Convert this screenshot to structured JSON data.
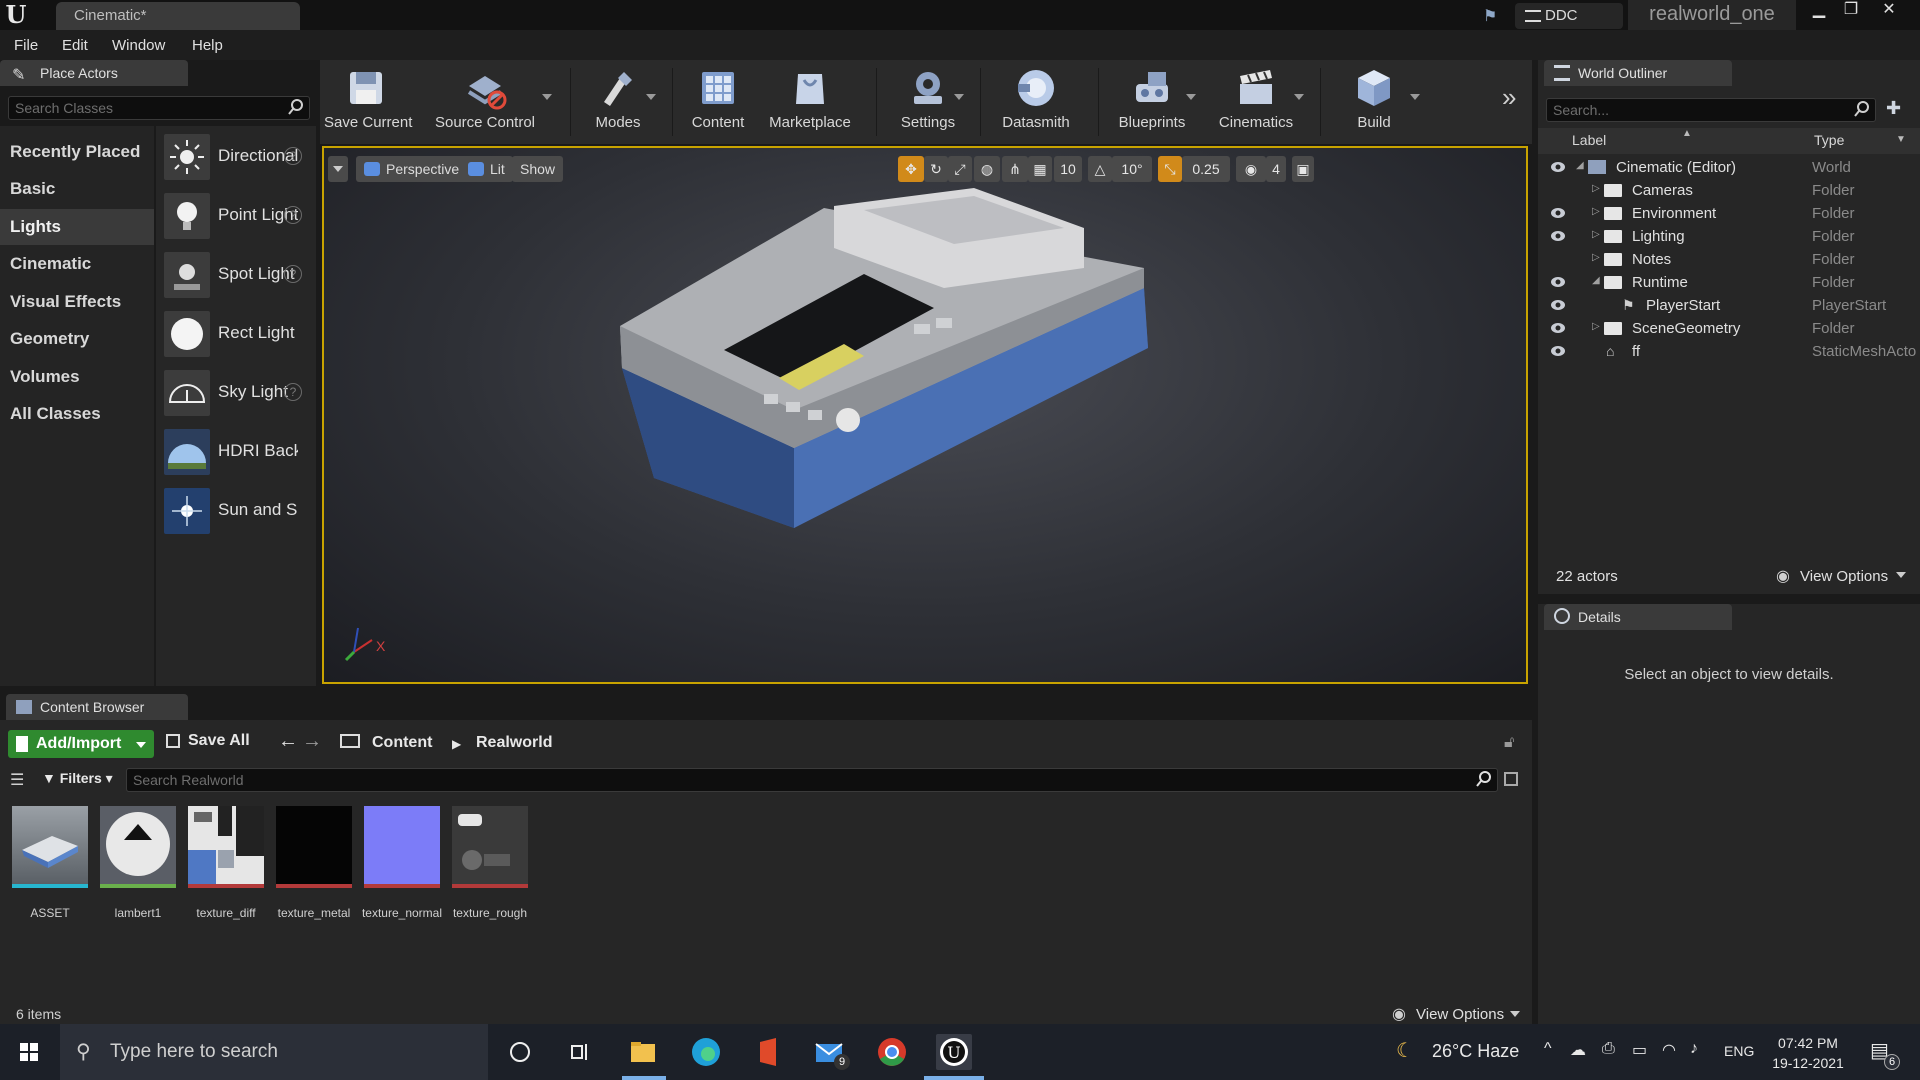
{
  "window": {
    "doc_tab": "Cinematic*",
    "ddc_label": "DDC",
    "project_name": "realworld_one"
  },
  "menu": [
    "File",
    "Edit",
    "Window",
    "Help"
  ],
  "place_actors": {
    "tab_label": "Place Actors",
    "search_placeholder": "Search Classes",
    "categories": [
      "Recently Placed",
      "Basic",
      "Lights",
      "Cinematic",
      "Visual Effects",
      "Geometry",
      "Volumes",
      "All Classes"
    ],
    "active_category": "Lights",
    "items": [
      {
        "label": "Directional Light",
        "icon": "directional-light-icon"
      },
      {
        "label": "Point Light",
        "icon": "point-light-icon"
      },
      {
        "label": "Spot Light",
        "icon": "spot-light-icon"
      },
      {
        "label": "Rect Light",
        "icon": "rect-light-icon"
      },
      {
        "label": "Sky Light",
        "icon": "sky-light-icon"
      },
      {
        "label": "HDRI Backdrop",
        "icon": "hdri-backdrop-icon"
      },
      {
        "label": "Sun and Sky",
        "icon": "sun-and-sky-icon"
      }
    ]
  },
  "toolbar": {
    "buttons": [
      {
        "label": "Save Current",
        "icon": "save-icon"
      },
      {
        "label": "Source Control",
        "icon": "source-control-icon"
      },
      {
        "label": "Modes",
        "icon": "modes-icon"
      },
      {
        "label": "Content",
        "icon": "content-icon"
      },
      {
        "label": "Marketplace",
        "icon": "marketplace-icon"
      },
      {
        "label": "Settings",
        "icon": "settings-icon"
      },
      {
        "label": "Datasmith",
        "icon": "datasmith-icon"
      },
      {
        "label": "Blueprints",
        "icon": "blueprints-icon"
      },
      {
        "label": "Cinematics",
        "icon": "cinematics-icon"
      },
      {
        "label": "Build",
        "icon": "build-icon"
      }
    ]
  },
  "viewport": {
    "perspective_label": "Perspective",
    "lit_label": "Lit",
    "show_label": "Show",
    "grid_snap": "10",
    "rotation_snap": "10°",
    "scale_snap": "0.25",
    "camera_speed": "4",
    "axis_x_label": "X"
  },
  "outliner": {
    "tab_label": "World Outliner",
    "search_placeholder": "Search...",
    "col_label": "Label",
    "col_type": "Type",
    "rows": [
      {
        "label": "Cinematic (Editor)",
        "type": "World",
        "kind": "world",
        "visible": true
      },
      {
        "label": "Cameras",
        "type": "Folder",
        "kind": "folder",
        "visible": false
      },
      {
        "label": "Environment",
        "type": "Folder",
        "kind": "folder",
        "visible": true
      },
      {
        "label": "Lighting",
        "type": "Folder",
        "kind": "folder",
        "visible": true
      },
      {
        "label": "Notes",
        "type": "Folder",
        "kind": "folder",
        "visible": false
      },
      {
        "label": "Runtime",
        "type": "Folder",
        "kind": "folder-open",
        "visible": true
      },
      {
        "label": "PlayerStart",
        "type": "PlayerStart",
        "kind": "actor",
        "visible": true
      },
      {
        "label": "SceneGeometry",
        "type": "Folder",
        "kind": "folder",
        "visible": true
      },
      {
        "label": "ff",
        "type": "StaticMeshActor",
        "kind": "mesh",
        "visible": true
      }
    ],
    "actor_count": "22 actors",
    "view_options": "View Options"
  },
  "details": {
    "tab_label": "Details",
    "empty_message": "Select an object to view details."
  },
  "content_browser": {
    "tab_label": "Content Browser",
    "add_import": "Add/Import",
    "save_all": "Save All",
    "path": [
      "Content",
      "Realworld"
    ],
    "filters_label": "Filters",
    "search_placeholder": "Search Realworld",
    "assets": [
      {
        "name": "ASSET",
        "bar_color": "#27b6cf"
      },
      {
        "name": "lambert1",
        "bar_color": "#6ab04c"
      },
      {
        "name": "texture_diff",
        "bar_color": "#b33a3a"
      },
      {
        "name": "texture_metal",
        "bar_color": "#b33a3a"
      },
      {
        "name": "texture_normal",
        "bar_color": "#b33a3a"
      },
      {
        "name": "texture_rough",
        "bar_color": "#b33a3a"
      }
    ],
    "item_count": "6 items",
    "view_options": "View Options"
  },
  "taskbar": {
    "search_placeholder": "Type here to search",
    "weather": "26°C  Haze",
    "language": "ENG",
    "time": "07:42 PM",
    "date": "19-12-2021",
    "mail_badge": "9",
    "notification_badge": "6"
  },
  "colors": {
    "accent_yellow": "#c8a300",
    "snap_orange": "#d18a1a",
    "add_green": "#2f8a2f"
  }
}
